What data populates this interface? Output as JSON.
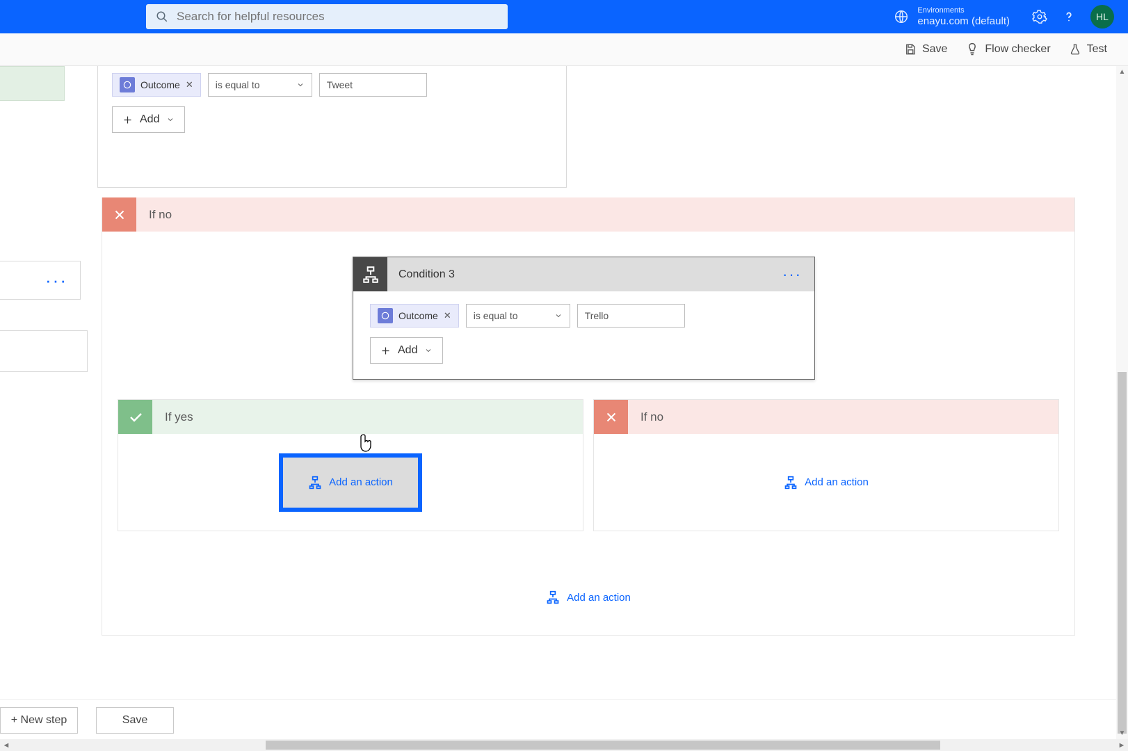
{
  "top": {
    "search_placeholder": "Search for helpful resources",
    "env_label": "Environments",
    "env_value": "enayu.com (default)",
    "avatar_initials": "HL"
  },
  "cmd": {
    "save": "Save",
    "checker": "Flow checker",
    "test": "Test"
  },
  "partial_condition": {
    "chip_label": "Outcome",
    "operator": "is equal to",
    "value": "Tweet",
    "add_label": "Add"
  },
  "stub2_dots": "···",
  "ifno_outer": {
    "header": "If no"
  },
  "condition3": {
    "title": "Condition 3",
    "menu_dots": "···",
    "chip_label": "Outcome",
    "operator": "is equal to",
    "value": "Trello",
    "add_label": "Add"
  },
  "inner_branches": {
    "yes_header": "If yes",
    "no_header": "If no",
    "add_action": "Add an action"
  },
  "lower_add_action": "Add an action",
  "outermost_add_action": "Add an action",
  "bottom": {
    "new_step": "+ New step",
    "save": "Save"
  }
}
